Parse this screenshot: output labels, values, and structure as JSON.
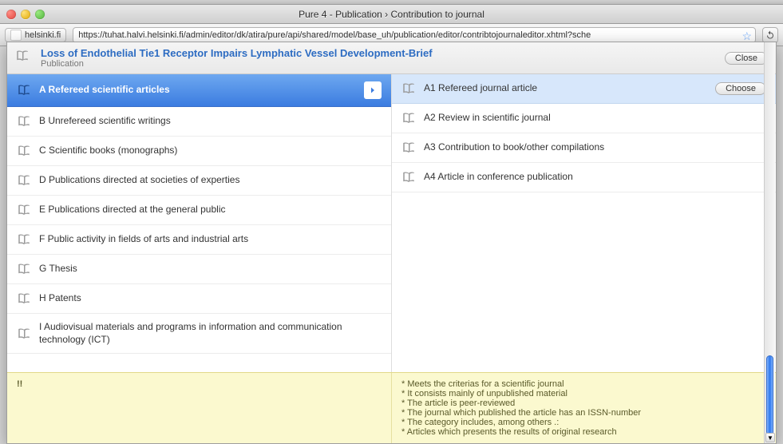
{
  "window": {
    "title": "Pure 4 - Publication › Contribution to journal"
  },
  "browser": {
    "site_label": "helsinki.fi",
    "url": "https://tuhat.halvi.helsinki.fi/admin/editor/dk/atira/pure/api/shared/model/base_uh/publication/editor/contribtojournaleditor.xhtml?sche"
  },
  "header": {
    "title": "Loss of Endothelial Tie1 Receptor Impairs Lymphatic Vessel Development-Brief",
    "subtitle": "Publication",
    "close_label": "Close"
  },
  "left_column": {
    "items": [
      {
        "label": "A Refereed scientific articles",
        "active": true
      },
      {
        "label": "B Unrefereed scientific writings"
      },
      {
        "label": "C Scientific books (monographs)"
      },
      {
        "label": "D Publications directed at societies of experties"
      },
      {
        "label": "E Publications directed at the general public"
      },
      {
        "label": "F Public activity in fields of arts and industrial arts"
      },
      {
        "label": "G Thesis"
      },
      {
        "label": "H Patents"
      },
      {
        "label": "I Audiovisual materials and programs in information and communication technology (ICT)"
      }
    ]
  },
  "right_column": {
    "choose_label": "Choose",
    "items": [
      {
        "label": "A1 Refereed journal article",
        "active": true
      },
      {
        "label": "A2 Review in scientific journal"
      },
      {
        "label": "A3 Contribution to book/other compilations"
      },
      {
        "label": "A4 Article in conference publication"
      }
    ]
  },
  "help": {
    "left_marker": "!!",
    "lines": [
      "Meets the criterias for a scientific journal",
      "It consists mainly of unpublished material",
      "The article is peer-reviewed",
      "The journal which published the article has an ISSN-number",
      "The category includes, among others .:",
      "Articles which presents the results of original research"
    ]
  }
}
